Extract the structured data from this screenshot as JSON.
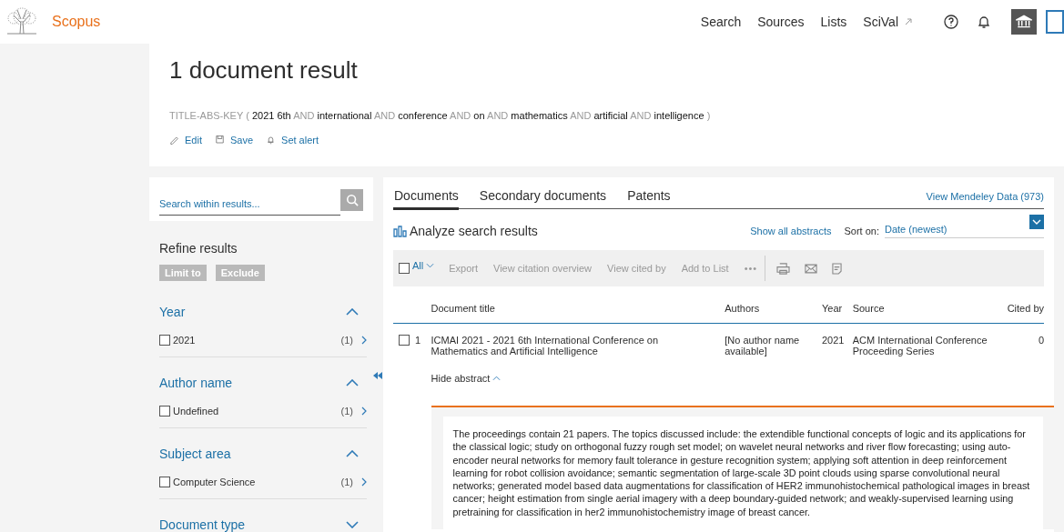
{
  "header": {
    "brand": "Scopus",
    "nav": [
      {
        "label": "Search",
        "external": false
      },
      {
        "label": "Sources",
        "external": false
      },
      {
        "label": "Lists",
        "external": false
      },
      {
        "label": "SciVal",
        "external": true
      }
    ]
  },
  "results": {
    "title": "1 document result",
    "query": [
      {
        "text": "TITLE-ABS-KEY (",
        "kind": "syntax"
      },
      {
        "text": "2021",
        "kind": "term"
      },
      {
        "text": "6th",
        "kind": "term"
      },
      {
        "text": "AND",
        "kind": "syntax"
      },
      {
        "text": "international",
        "kind": "term"
      },
      {
        "text": "AND",
        "kind": "syntax"
      },
      {
        "text": "conference",
        "kind": "term"
      },
      {
        "text": "AND",
        "kind": "syntax"
      },
      {
        "text": "on",
        "kind": "term"
      },
      {
        "text": "AND",
        "kind": "syntax"
      },
      {
        "text": "mathematics",
        "kind": "term"
      },
      {
        "text": "AND",
        "kind": "syntax"
      },
      {
        "text": "artificial",
        "kind": "term"
      },
      {
        "text": "AND",
        "kind": "syntax"
      },
      {
        "text": "intelligence",
        "kind": "term"
      },
      {
        "text": ")",
        "kind": "syntax"
      }
    ],
    "actions": [
      {
        "label": "Edit",
        "kind": "edit"
      },
      {
        "label": "Save",
        "kind": "save"
      },
      {
        "label": "Set alert",
        "kind": "alert"
      }
    ]
  },
  "sidebar": {
    "search": {
      "placeholder": "Search within results..."
    },
    "refine_title": "Refine results",
    "filter_buttons": [
      "Limit to",
      "Exclude"
    ],
    "facets": [
      {
        "title": "Year",
        "expanded": true,
        "items": [
          {
            "label": "2021",
            "count": "(1)",
            "checked": false
          }
        ]
      },
      {
        "title": "Author name",
        "expanded": true,
        "items": [
          {
            "label": "Undefined",
            "count": "(1)",
            "checked": false
          }
        ]
      },
      {
        "title": "Subject area",
        "expanded": true,
        "items": [
          {
            "label": "Computer Science",
            "count": "(1)",
            "checked": false
          }
        ]
      },
      {
        "title": "Document type",
        "expanded": false
      }
    ]
  },
  "tabs": [
    {
      "label": "Documents",
      "selected": true
    },
    {
      "label": "Secondary documents",
      "selected": false
    },
    {
      "label": "Patents",
      "selected": false
    }
  ],
  "mendeley_link": "View Mendeley Data (973)",
  "analyze": "Analyze search results",
  "show_abstracts": "Show all abstracts",
  "sort": {
    "label": "Sort on:",
    "value": "Date (newest)"
  },
  "toolbar": {
    "select_all": {
      "label": "All",
      "checked": false
    },
    "actions": [
      "Export",
      "View citation overview",
      "View cited by",
      "Add to List"
    ],
    "more": "•••"
  },
  "table": {
    "columns": [
      "Document title",
      "Authors",
      "Year",
      "Source",
      "Cited by"
    ],
    "rows": [
      {
        "index": "1",
        "checked": false,
        "title": "ICMAI 2021 - 2021 6th International Conference on Mathematics and Artificial Intelligence",
        "authors": "[No author name available]",
        "year": "2021",
        "source": "ACM International Conference Proceeding Series",
        "cited_by": "0",
        "abstract_expanded": true,
        "abstract_toggle": "Hide abstract",
        "abstract": "The proceedings contain 21 papers. The topics discussed include: the extendible functional concepts of logic and its applications for the classical logic; study on orthogonal fuzzy rough set model; on wavelet neural networks and river flow forecasting; using auto-encoder neural networks for memory fault tolerance in gesture recognition system; applying soft attention in deep reinforcement learning for robot collision avoidance; semantic segmentation of large-scale 3D point clouds using sparse convolutional neural networks; generated model based data augmentations for classification of HER2 immunohistochemical pathological images in breast cancer; height estimation from single aerial imagery with a deep boundary-guided network; and weakly-supervised learning using pretraining for classification in her2 immunohistochemistry image of breast cancer."
      }
    ]
  }
}
